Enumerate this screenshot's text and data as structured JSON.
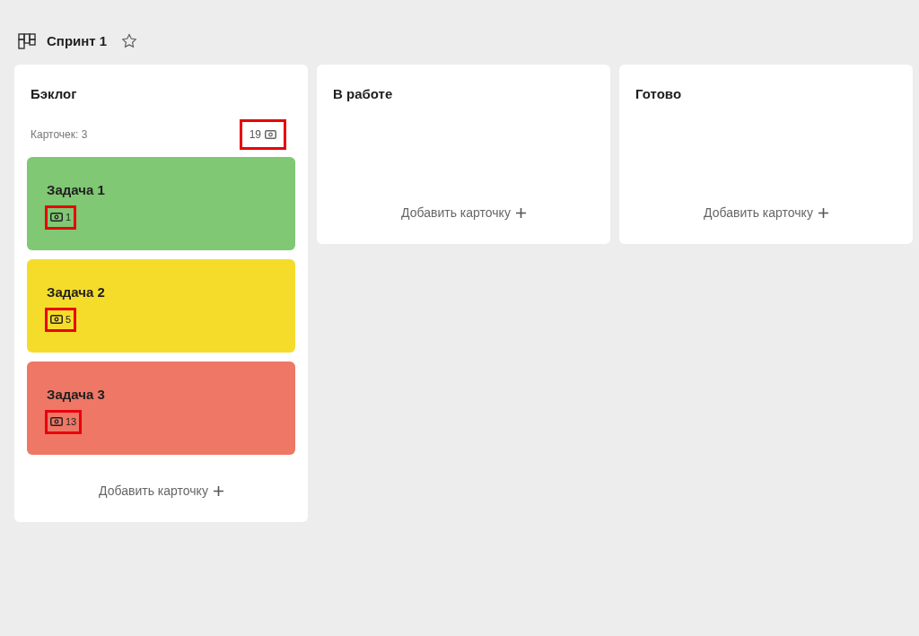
{
  "board": {
    "title": "Спринт 1",
    "starred": false
  },
  "columns": [
    {
      "title": "Бэклог",
      "count_label": "Карточек: 3",
      "points": {
        "value": "19",
        "highlighted": true
      },
      "add_label": "Добавить карточку",
      "cards": [
        {
          "title": "Задача 1",
          "color": "#80c873",
          "points": {
            "value": "1",
            "highlighted": true
          }
        },
        {
          "title": "Задача 2",
          "color": "#f6dc2a",
          "points": {
            "value": "5",
            "highlighted": true
          }
        },
        {
          "title": "Задача 3",
          "color": "#ef7766",
          "points": {
            "value": "13",
            "highlighted": true
          }
        }
      ]
    },
    {
      "title": "В работе",
      "add_label": "Добавить карточку"
    },
    {
      "title": "Готово",
      "add_label": "Добавить карточку"
    }
  ]
}
